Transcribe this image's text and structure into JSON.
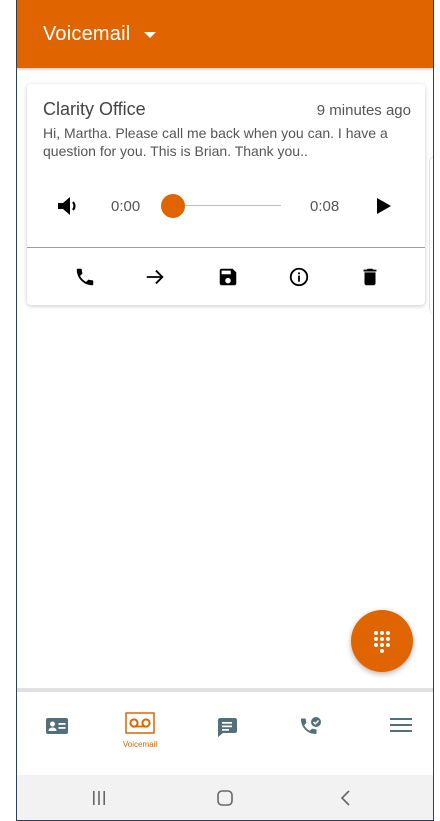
{
  "appbar": {
    "title": "Voicemail",
    "caret_icon": "caret-down-icon"
  },
  "voicemail": {
    "caller": "Clarity Office",
    "time_ago": "9 minutes ago",
    "transcript": "Hi, Martha. Please call me back when you can. I have a question for you. This is Brian. Thank you..",
    "player": {
      "current_time": "0:00",
      "duration": "0:08",
      "progress": 0.0,
      "volume_icon": "volume-icon",
      "play_icon": "play-icon"
    },
    "actions": [
      {
        "name": "call-back",
        "icon": "phone-icon"
      },
      {
        "name": "forward",
        "icon": "arrow-right-icon"
      },
      {
        "name": "save",
        "icon": "save-icon"
      },
      {
        "name": "info",
        "icon": "info-icon"
      },
      {
        "name": "delete",
        "icon": "trash-icon"
      }
    ]
  },
  "fab": {
    "icon": "dialpad-icon"
  },
  "bottom_nav": {
    "items": [
      {
        "name": "contacts",
        "icon": "contact-card-icon"
      },
      {
        "name": "voicemail",
        "icon": "voicemail-icon",
        "label": "Voicemail",
        "active": true
      },
      {
        "name": "messages",
        "icon": "message-icon"
      },
      {
        "name": "calls",
        "icon": "call-history-icon"
      },
      {
        "name": "menu",
        "icon": "hamburger-icon"
      }
    ]
  },
  "system_nav": [
    "recent-apps-icon",
    "home-icon",
    "back-icon"
  ],
  "colors": {
    "brand": "#e06400",
    "icon": "#000000",
    "nav_icon": "#546e7a",
    "text_secondary": "#555555"
  }
}
